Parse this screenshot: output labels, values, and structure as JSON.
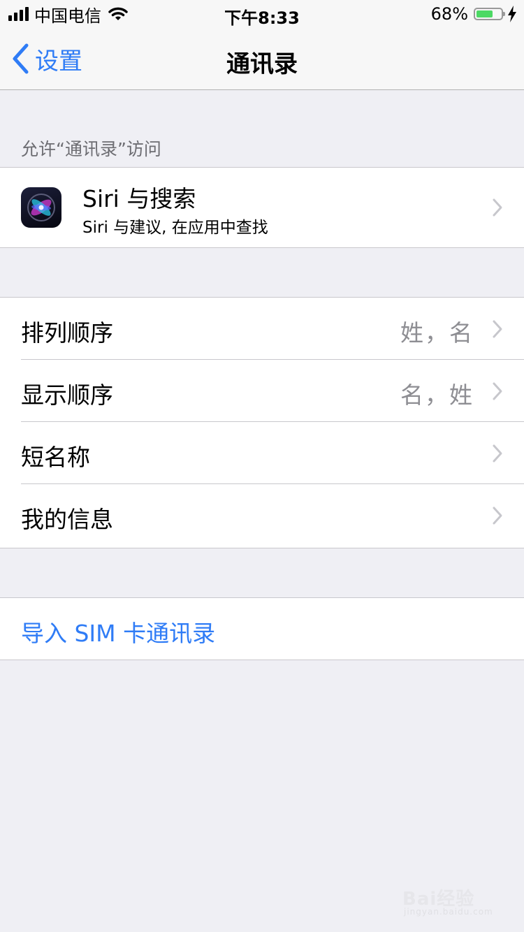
{
  "status_bar": {
    "carrier": "中国电信",
    "time": "下午8:33",
    "battery_percent": "68%",
    "battery_level": 0.68,
    "icons": [
      "signal-icon",
      "wifi-icon",
      "battery-icon",
      "charging-bolt-icon"
    ]
  },
  "nav": {
    "back_label": "设置",
    "title": "通讯录"
  },
  "section_header": "允许“通讯录”访问",
  "siri": {
    "title": "Siri 与搜索",
    "subtitle": "Siri 与建议, 在应用中查找",
    "icon": "siri-icon"
  },
  "rows": [
    {
      "label": "排列顺序",
      "value": "姓，名"
    },
    {
      "label": "显示顺序",
      "value": "名，姓"
    },
    {
      "label": "短名称",
      "value": ""
    },
    {
      "label": "我的信息",
      "value": ""
    }
  ],
  "import_sim_label": "导入 SIM 卡通讯录",
  "watermark": {
    "main": "Bai经验",
    "sub": "jingyan.baidu.com"
  },
  "colors": {
    "accent": "#2f7cf6",
    "background": "#efeff4",
    "battery": "#4cd964"
  }
}
